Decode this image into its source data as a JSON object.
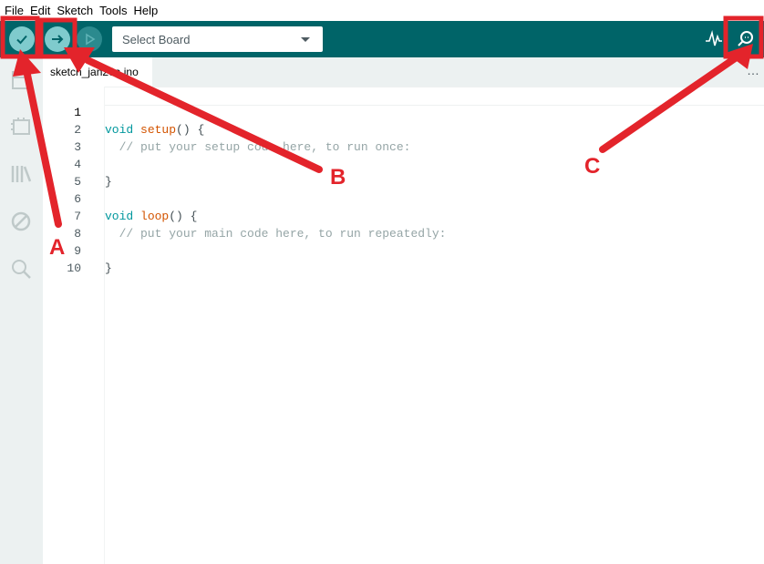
{
  "menu": {
    "file": "File",
    "edit": "Edit",
    "sketch": "Sketch",
    "tools": "Tools",
    "help": "Help"
  },
  "toolbar": {
    "verify_icon": "check-icon",
    "upload_icon": "arrow-right-icon",
    "debug_icon": "play-icon",
    "board_select": "Select Board",
    "serial_plotter_icon": "plotter-icon",
    "serial_monitor_icon": "magnifier-icon",
    "accent": "#006468"
  },
  "sidebar": {
    "items": [
      "sketchbook-icon",
      "boards-manager-icon",
      "library-manager-icon",
      "debug-icon",
      "search-icon"
    ]
  },
  "tab": {
    "label": "sketch_jan26a.ino",
    "more": "…"
  },
  "editor": {
    "lines": [
      {
        "num": "1"
      },
      {
        "num": "2"
      },
      {
        "num": "3"
      },
      {
        "num": "4"
      },
      {
        "num": "5"
      },
      {
        "num": "6"
      },
      {
        "num": "7"
      },
      {
        "num": "8"
      },
      {
        "num": "9"
      },
      {
        "num": "10"
      }
    ],
    "code": {
      "l1_kw": "void",
      "l1_fn": "setup",
      "l1_rest": "() {",
      "l2": "  // put your setup code here, to run once:",
      "l4": "}",
      "l6_kw": "void",
      "l6_fn": "loop",
      "l6_rest": "() {",
      "l7": "  // put your main code here, to run repeatedly:",
      "l9": "}"
    }
  },
  "annotations": {
    "a": "A",
    "b": "B",
    "c": "C",
    "color": "#e3242b"
  }
}
